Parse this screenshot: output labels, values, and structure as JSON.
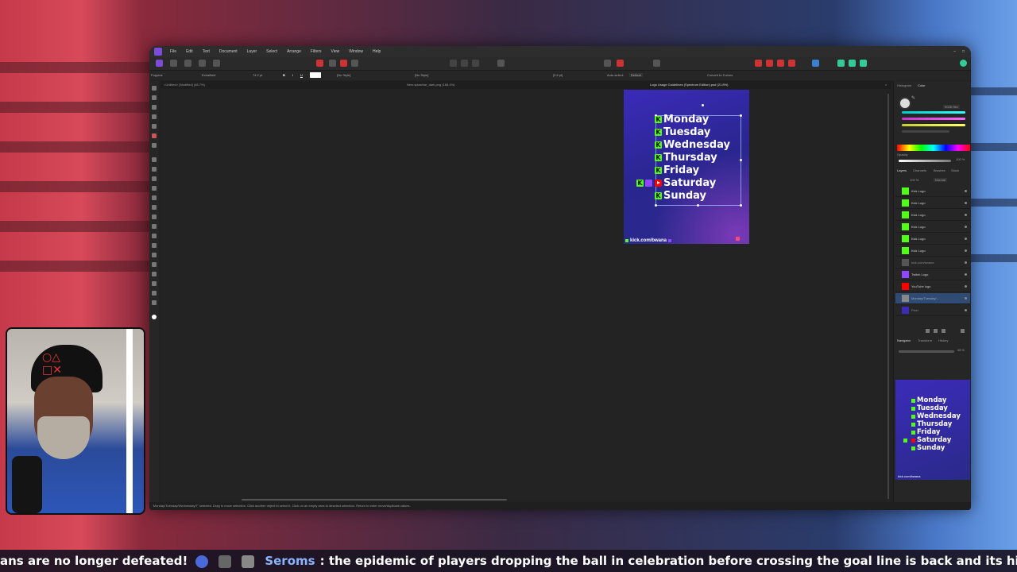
{
  "app": {
    "menu": [
      "File",
      "Edit",
      "Text",
      "Document",
      "Layer",
      "Select",
      "Arrange",
      "Filters",
      "View",
      "Window",
      "Help"
    ],
    "context": {
      "font_family": "Poppins",
      "font_style": "ExtraBold",
      "font_size": "74.2 pt",
      "bold": "B",
      "italic": "I",
      "underline": "U",
      "no_style": "[No Style]",
      "no_style_2": "[No Style]",
      "tracking": "[0.6 pt]",
      "auto_select": "Auto-select:",
      "default": "Default",
      "convert": "Convert to Curves"
    },
    "tabs": [
      "<Untitled> [Modified] (48.7%)",
      "New-splashlar_dark.png (168.4%)",
      "Logo Usage Guidelines (Spectrum Edition).psd (21.8%)"
    ],
    "document": {
      "days": [
        "Monday",
        "Tuesday",
        "Wednesday",
        "Thursday",
        "Friday",
        "Saturday",
        "Sunday"
      ],
      "url": "kick.com/bwana"
    },
    "panels": {
      "top_tabs": [
        "Histogram",
        "Color"
      ],
      "hex": "9028 Hex",
      "opacity_label": "Opacity",
      "opacity_value": "100 %",
      "layer_tabs": [
        "Layers",
        "Channels",
        "Brushes",
        "Stock"
      ],
      "layer_opacity": "100 %",
      "blend_mode": "Normal",
      "layers": [
        "Kick Logo",
        "Kick Logo",
        "Kick Logo",
        "Kick Logo",
        "Kick Logo",
        "Kick Logo",
        "kick.com/bwana",
        "Twitch Logo",
        "YouTube logo",
        "Monday/Tuesday/...",
        "Pixel"
      ],
      "nav_tabs": [
        "Navigator",
        "Transform",
        "History"
      ],
      "zoom": "48 %"
    },
    "status": "'Monday/Tuesday/Wednesday/T' selected. Drag to move selection. Click another object to select it. Click on an empty area to deselect selection. Return to enter move/duplicate values."
  },
  "ticker": {
    "lead": "ans are no longer defeated!",
    "user": "Seroms",
    "sep": ":",
    "message": "the epidemic of players dropping the ball in celebration before crossing the goal line is back and its hilarious"
  },
  "colors": {
    "kick_green": "#53fc18",
    "twitch_purple": "#9146ff",
    "youtube_red": "#ff0000",
    "doc_bg": "#2a2690"
  }
}
